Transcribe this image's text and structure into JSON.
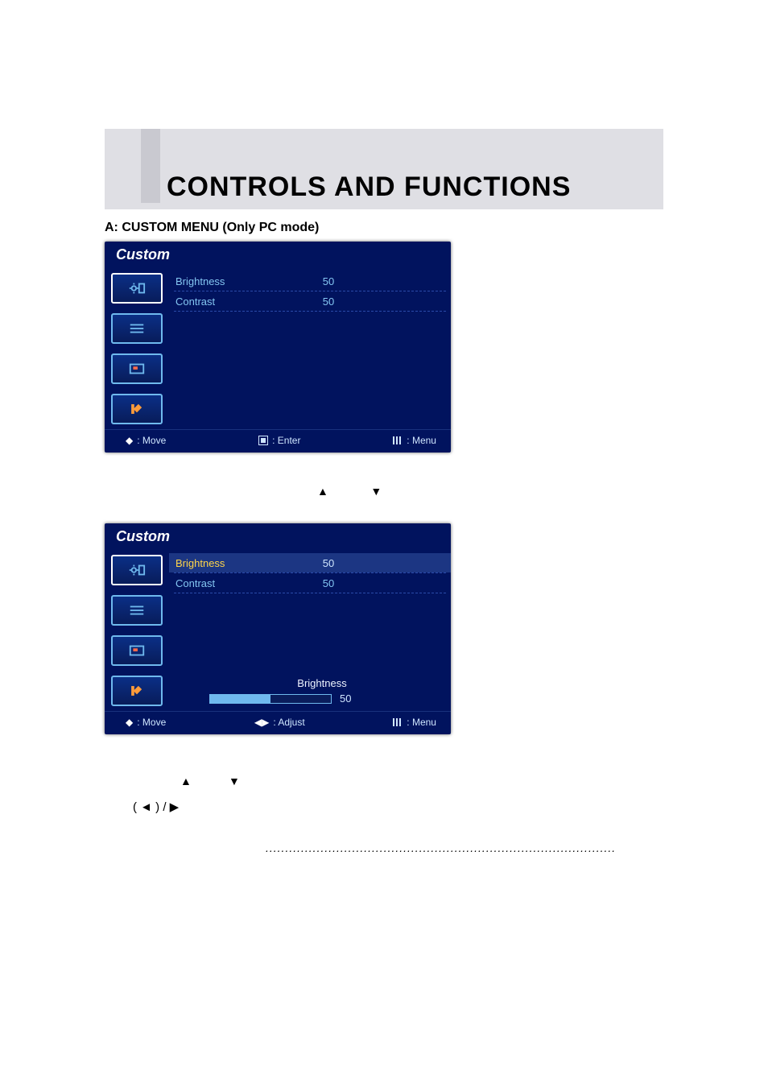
{
  "header": {
    "title": "CONTROLS AND FUNCTIONS"
  },
  "section": {
    "label": "A: CUSTOM MENU (Only PC mode)"
  },
  "osd1": {
    "title": "Custom",
    "rows": [
      {
        "label": "Brightness",
        "value": "50"
      },
      {
        "label": "Contrast",
        "value": "50"
      }
    ],
    "footer": {
      "move": ": Move",
      "enter": ": Enter",
      "menu": ": Menu"
    }
  },
  "mid_arrows": {
    "up": "▲",
    "down": "▼"
  },
  "osd2": {
    "title": "Custom",
    "rows": [
      {
        "label": "Brightness",
        "value": "50"
      },
      {
        "label": "Contrast",
        "value": "50"
      }
    ],
    "slider": {
      "label": "Brightness",
      "value": "50"
    },
    "footer": {
      "move": ": Move",
      "adjust": ": Adjust",
      "menu": ": Menu"
    }
  },
  "symbol_line": {
    "text": "(  ◄  ) /        ▶",
    "above": "▲         ▼"
  },
  "dots": "........................................................................................."
}
